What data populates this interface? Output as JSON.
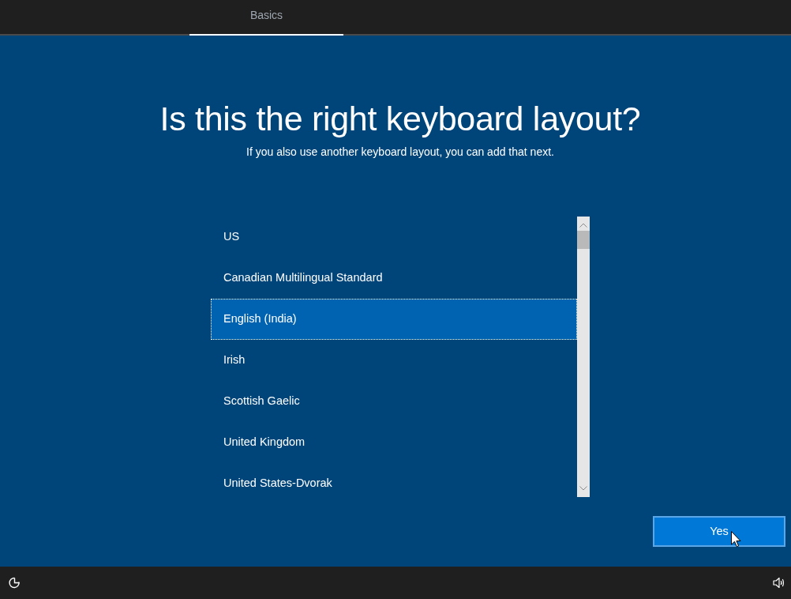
{
  "tabs": [
    {
      "label": "Basics",
      "selected": true
    }
  ],
  "heading": "Is this the right keyboard layout?",
  "subheading": "If you also use another keyboard layout, you can add that next.",
  "layouts": [
    {
      "label": "US",
      "selected": false
    },
    {
      "label": "Canadian Multilingual Standard",
      "selected": false
    },
    {
      "label": "English (India)",
      "selected": true
    },
    {
      "label": "Irish",
      "selected": false
    },
    {
      "label": "Scottish Gaelic",
      "selected": false
    },
    {
      "label": "United Kingdom",
      "selected": false
    },
    {
      "label": "United States-Dvorak",
      "selected": false
    }
  ],
  "buttons": [
    {
      "label": "Yes"
    }
  ]
}
